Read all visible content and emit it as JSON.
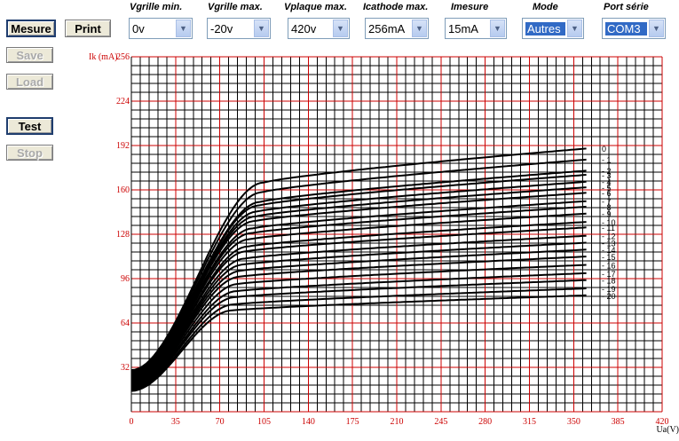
{
  "buttons": {
    "mesure": "Mesure",
    "print": "Print",
    "save": "Save",
    "load": "Load",
    "test": "Test",
    "stop": "Stop"
  },
  "params": [
    {
      "label": "Vgrille min.",
      "value": "0v"
    },
    {
      "label": "Vgrille max.",
      "value": "-20v"
    },
    {
      "label": "Vplaque max.",
      "value": "420v"
    },
    {
      "label": "Icathode max.",
      "value": "256mA"
    },
    {
      "label": "Imesure",
      "value": "15mA"
    },
    {
      "label": "Mode",
      "value": "Autres"
    },
    {
      "label": "Port série",
      "value": "COM3"
    }
  ],
  "icons": {
    "dropdown": "chevron-down-icon"
  },
  "colors": {
    "grid_major": "#cc0000",
    "grid_minor": "#000000",
    "curve": "#000000",
    "axis_text": "#cc0000",
    "highlight": "#316ac5"
  },
  "chart_data": {
    "type": "line",
    "ylabel": "Ik (mA)",
    "xlabel": "Ua(V)",
    "xlim": [
      0,
      420
    ],
    "ylim": [
      0,
      256
    ],
    "xticks": [
      0,
      35,
      70,
      105,
      140,
      175,
      210,
      245,
      280,
      315,
      350,
      385,
      420
    ],
    "yticks": [
      32,
      64,
      96,
      128,
      160,
      192,
      224,
      256
    ],
    "grid": true,
    "series_labels": [
      "0",
      "- 1",
      "- 2",
      "- 3",
      "- 4",
      "- 5",
      "- 6",
      "- 7",
      "- 8",
      "- 9",
      "- 10",
      "- 11",
      "- 12",
      "- 13",
      "- 14",
      "- 15",
      "- 16",
      "- 17",
      "- 18",
      "- 19",
      "- 20"
    ],
    "series_end_values": [
      190,
      182,
      174,
      171,
      166,
      162,
      158,
      152,
      148,
      143,
      137,
      133,
      127,
      122,
      117,
      112,
      106,
      100,
      95,
      89,
      84
    ]
  }
}
